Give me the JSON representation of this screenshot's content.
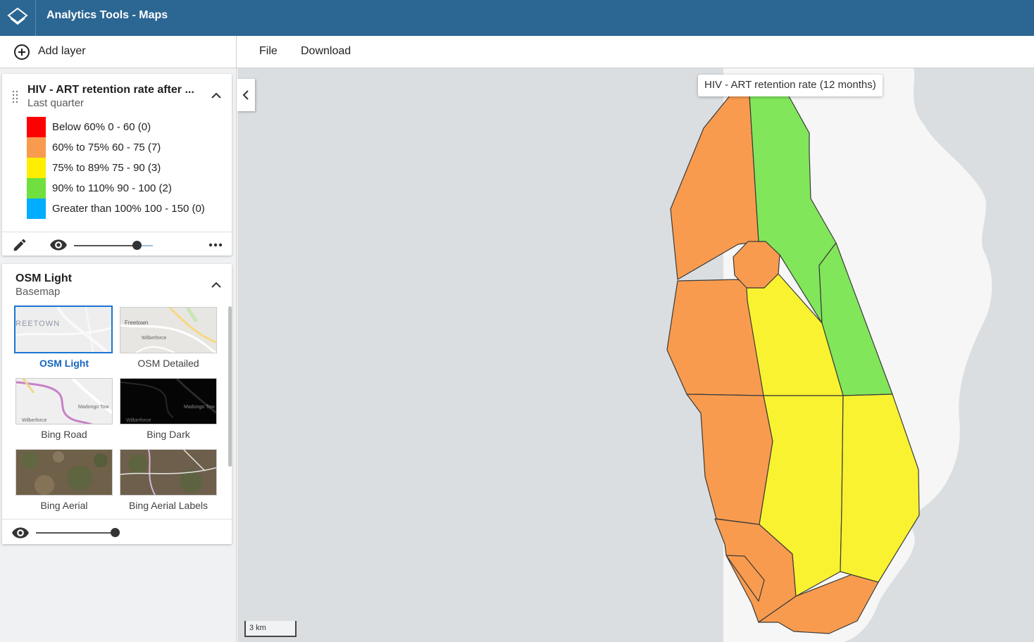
{
  "app": {
    "title": "Analytics Tools - Maps",
    "logo_icon": "layers-logo-icon"
  },
  "toolbar": {
    "add_layer_label": "Add layer",
    "add_layer_icon": "add-circle-icon",
    "menu": [
      "File",
      "Download"
    ]
  },
  "thematic_layer": {
    "title": "HIV - ART retention rate after ...",
    "period": "Last quarter",
    "legend": [
      {
        "label": "Below 60% 0 - 60 (0)",
        "color": "#ff0000"
      },
      {
        "label": "60% to 75% 60 - 75 (7)",
        "color": "#f89b4f"
      },
      {
        "label": "75% to 89% 75 - 90 (3)",
        "color": "#ffee00"
      },
      {
        "label": "90% to 110% 90 - 100 (2)",
        "color": "#6fe03f"
      },
      {
        "label": "Greater than 100% 100 - 150 (0)",
        "color": "#00adff"
      }
    ],
    "opacity": 0.8,
    "icons": [
      "drag-handle-icon",
      "chevron-up-icon",
      "edit-icon",
      "eye-icon",
      "more-icon"
    ]
  },
  "basemap_layer": {
    "title": "OSM Light",
    "subtitle": "Basemap",
    "selected": "OSM Light",
    "options": [
      "OSM Light",
      "OSM Detailed",
      "Bing Road",
      "Bing Dark",
      "Bing Aerial",
      "Bing Aerial Labels"
    ],
    "thumb_text": {
      "osm_light": "REETOWN",
      "osm_detailed": [
        "Freetown",
        "Wilberforce"
      ],
      "bing_road": [
        "Madongo Tow",
        "Wilberforce"
      ],
      "bing_dark": [
        "Madongo Tow",
        "Wilberforce"
      ]
    },
    "opacity": 1.0
  },
  "map": {
    "tooltip": "HIV - ART retention rate (12 months)",
    "scale_label": "3 km",
    "colors": {
      "orange": "#f89b4f",
      "yellow": "#f9f230",
      "green": "#81e65a",
      "land": "#f6f6f6",
      "water": "#dadee0"
    }
  }
}
